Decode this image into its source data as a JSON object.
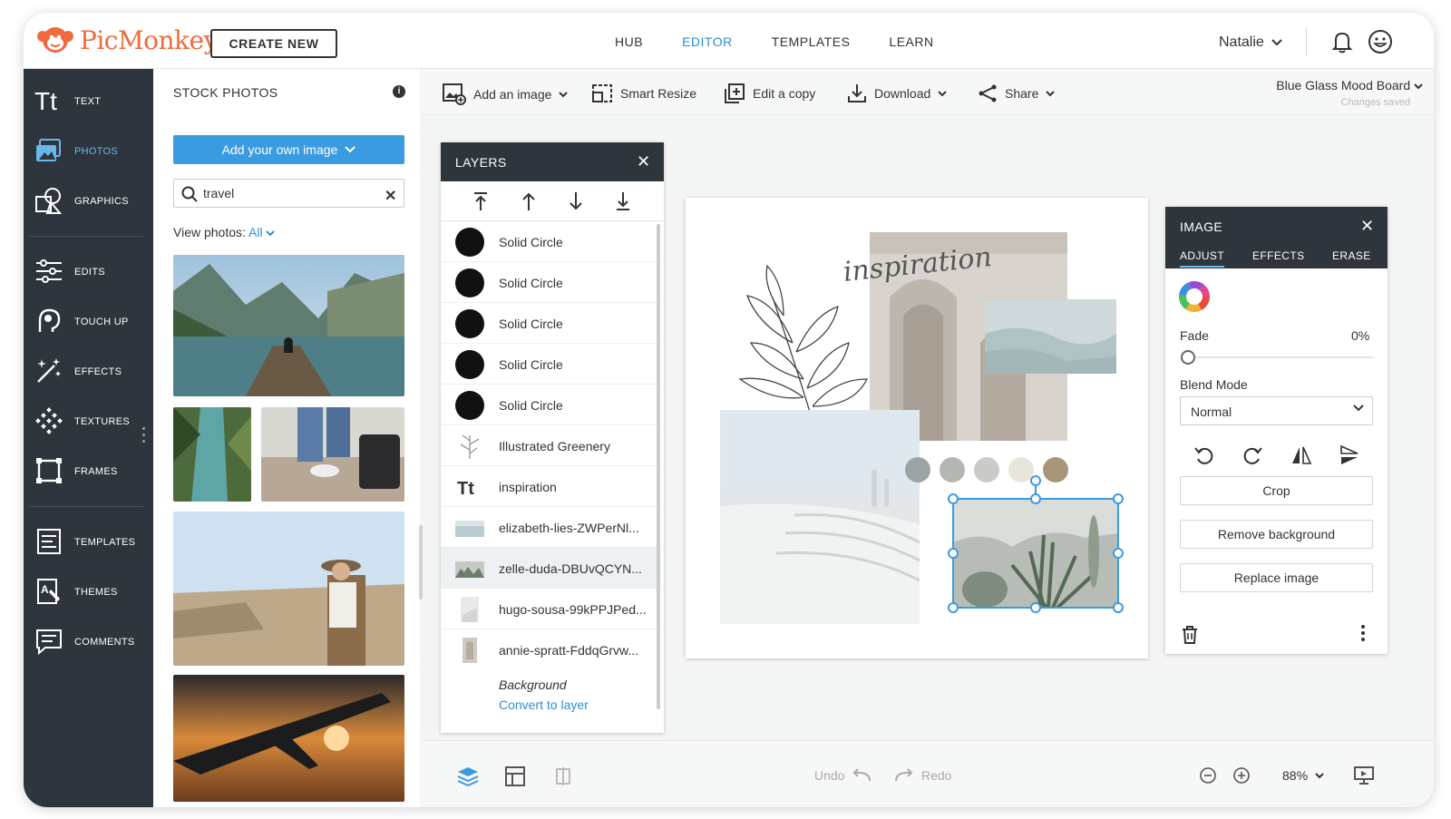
{
  "brand": {
    "name": "PicMonkey",
    "color": "#ef6b3d"
  },
  "header": {
    "create_new": "CREATE NEW",
    "nav": [
      {
        "label": "HUB",
        "active": false
      },
      {
        "label": "EDITOR",
        "active": true
      },
      {
        "label": "TEMPLATES",
        "active": false
      },
      {
        "label": "LEARN",
        "active": false
      }
    ],
    "user_name": "Natalie",
    "accent": "#2d8fd5"
  },
  "rail": {
    "items": [
      {
        "label": "TEXT",
        "icon": "text-icon",
        "active": false
      },
      {
        "label": "PHOTOS",
        "icon": "photos-icon",
        "active": true
      },
      {
        "label": "GRAPHICS",
        "icon": "graphics-icon",
        "active": false
      },
      {
        "label": "EDITS",
        "icon": "edits-icon",
        "active": false
      },
      {
        "label": "TOUCH UP",
        "icon": "touch-up-icon",
        "active": false
      },
      {
        "label": "EFFECTS",
        "icon": "effects-icon",
        "active": false
      },
      {
        "label": "TEXTURES",
        "icon": "textures-icon",
        "active": false
      },
      {
        "label": "FRAMES",
        "icon": "frames-icon",
        "active": false
      },
      {
        "label": "TEMPLATES",
        "icon": "templates-icon",
        "active": false
      },
      {
        "label": "THEMES",
        "icon": "themes-icon",
        "active": false
      },
      {
        "label": "COMMENTS",
        "icon": "comments-icon",
        "active": false
      }
    ]
  },
  "stock": {
    "title": "STOCK PHOTOS",
    "add_own": "Add your own image",
    "search_value": "travel",
    "view_label": "View photos:",
    "view_value": "All"
  },
  "toolbar": {
    "add_image": "Add an image",
    "smart_resize": "Smart Resize",
    "edit_copy": "Edit a copy",
    "download": "Download",
    "share": "Share",
    "doc_title": "Blue Glass Mood Board",
    "doc_status": "Changes saved"
  },
  "layers": {
    "title": "LAYERS",
    "rows": [
      {
        "name": "Solid Circle",
        "thumb": "circle"
      },
      {
        "name": "Solid Circle",
        "thumb": "circle"
      },
      {
        "name": "Solid Circle",
        "thumb": "circle"
      },
      {
        "name": "Solid Circle",
        "thumb": "circle"
      },
      {
        "name": "Solid Circle",
        "thumb": "circle"
      },
      {
        "name": "Illustrated Greenery",
        "thumb": "greenery"
      },
      {
        "name": "inspiration",
        "thumb": "text"
      },
      {
        "name": "elizabeth-lies-ZWPerNl...",
        "thumb": "photo"
      },
      {
        "name": "zelle-duda-DBUvQCYN...",
        "thumb": "photo",
        "selected": true
      },
      {
        "name": "hugo-sousa-99kPPJPed...",
        "thumb": "photo"
      },
      {
        "name": "annie-spratt-FddqGrvw...",
        "thumb": "photo"
      }
    ],
    "background_label": "Background",
    "convert_link": "Convert to layer"
  },
  "canvas": {
    "script_text": "inspiration",
    "swatches": [
      "#9aa4a4",
      "#b3b7b2",
      "#c9cbc7",
      "#e9e5da",
      "#a8967a"
    ]
  },
  "image_panel": {
    "title": "IMAGE",
    "tabs": [
      "ADJUST",
      "EFFECTS",
      "ERASE"
    ],
    "fade_label": "Fade",
    "fade_value": "0%",
    "blend_label": "Blend Mode",
    "blend_value": "Normal",
    "crop": "Crop",
    "remove_bg": "Remove background",
    "replace": "Replace image"
  },
  "bottom": {
    "undo": "Undo",
    "redo": "Redo",
    "zoom": "88%"
  }
}
